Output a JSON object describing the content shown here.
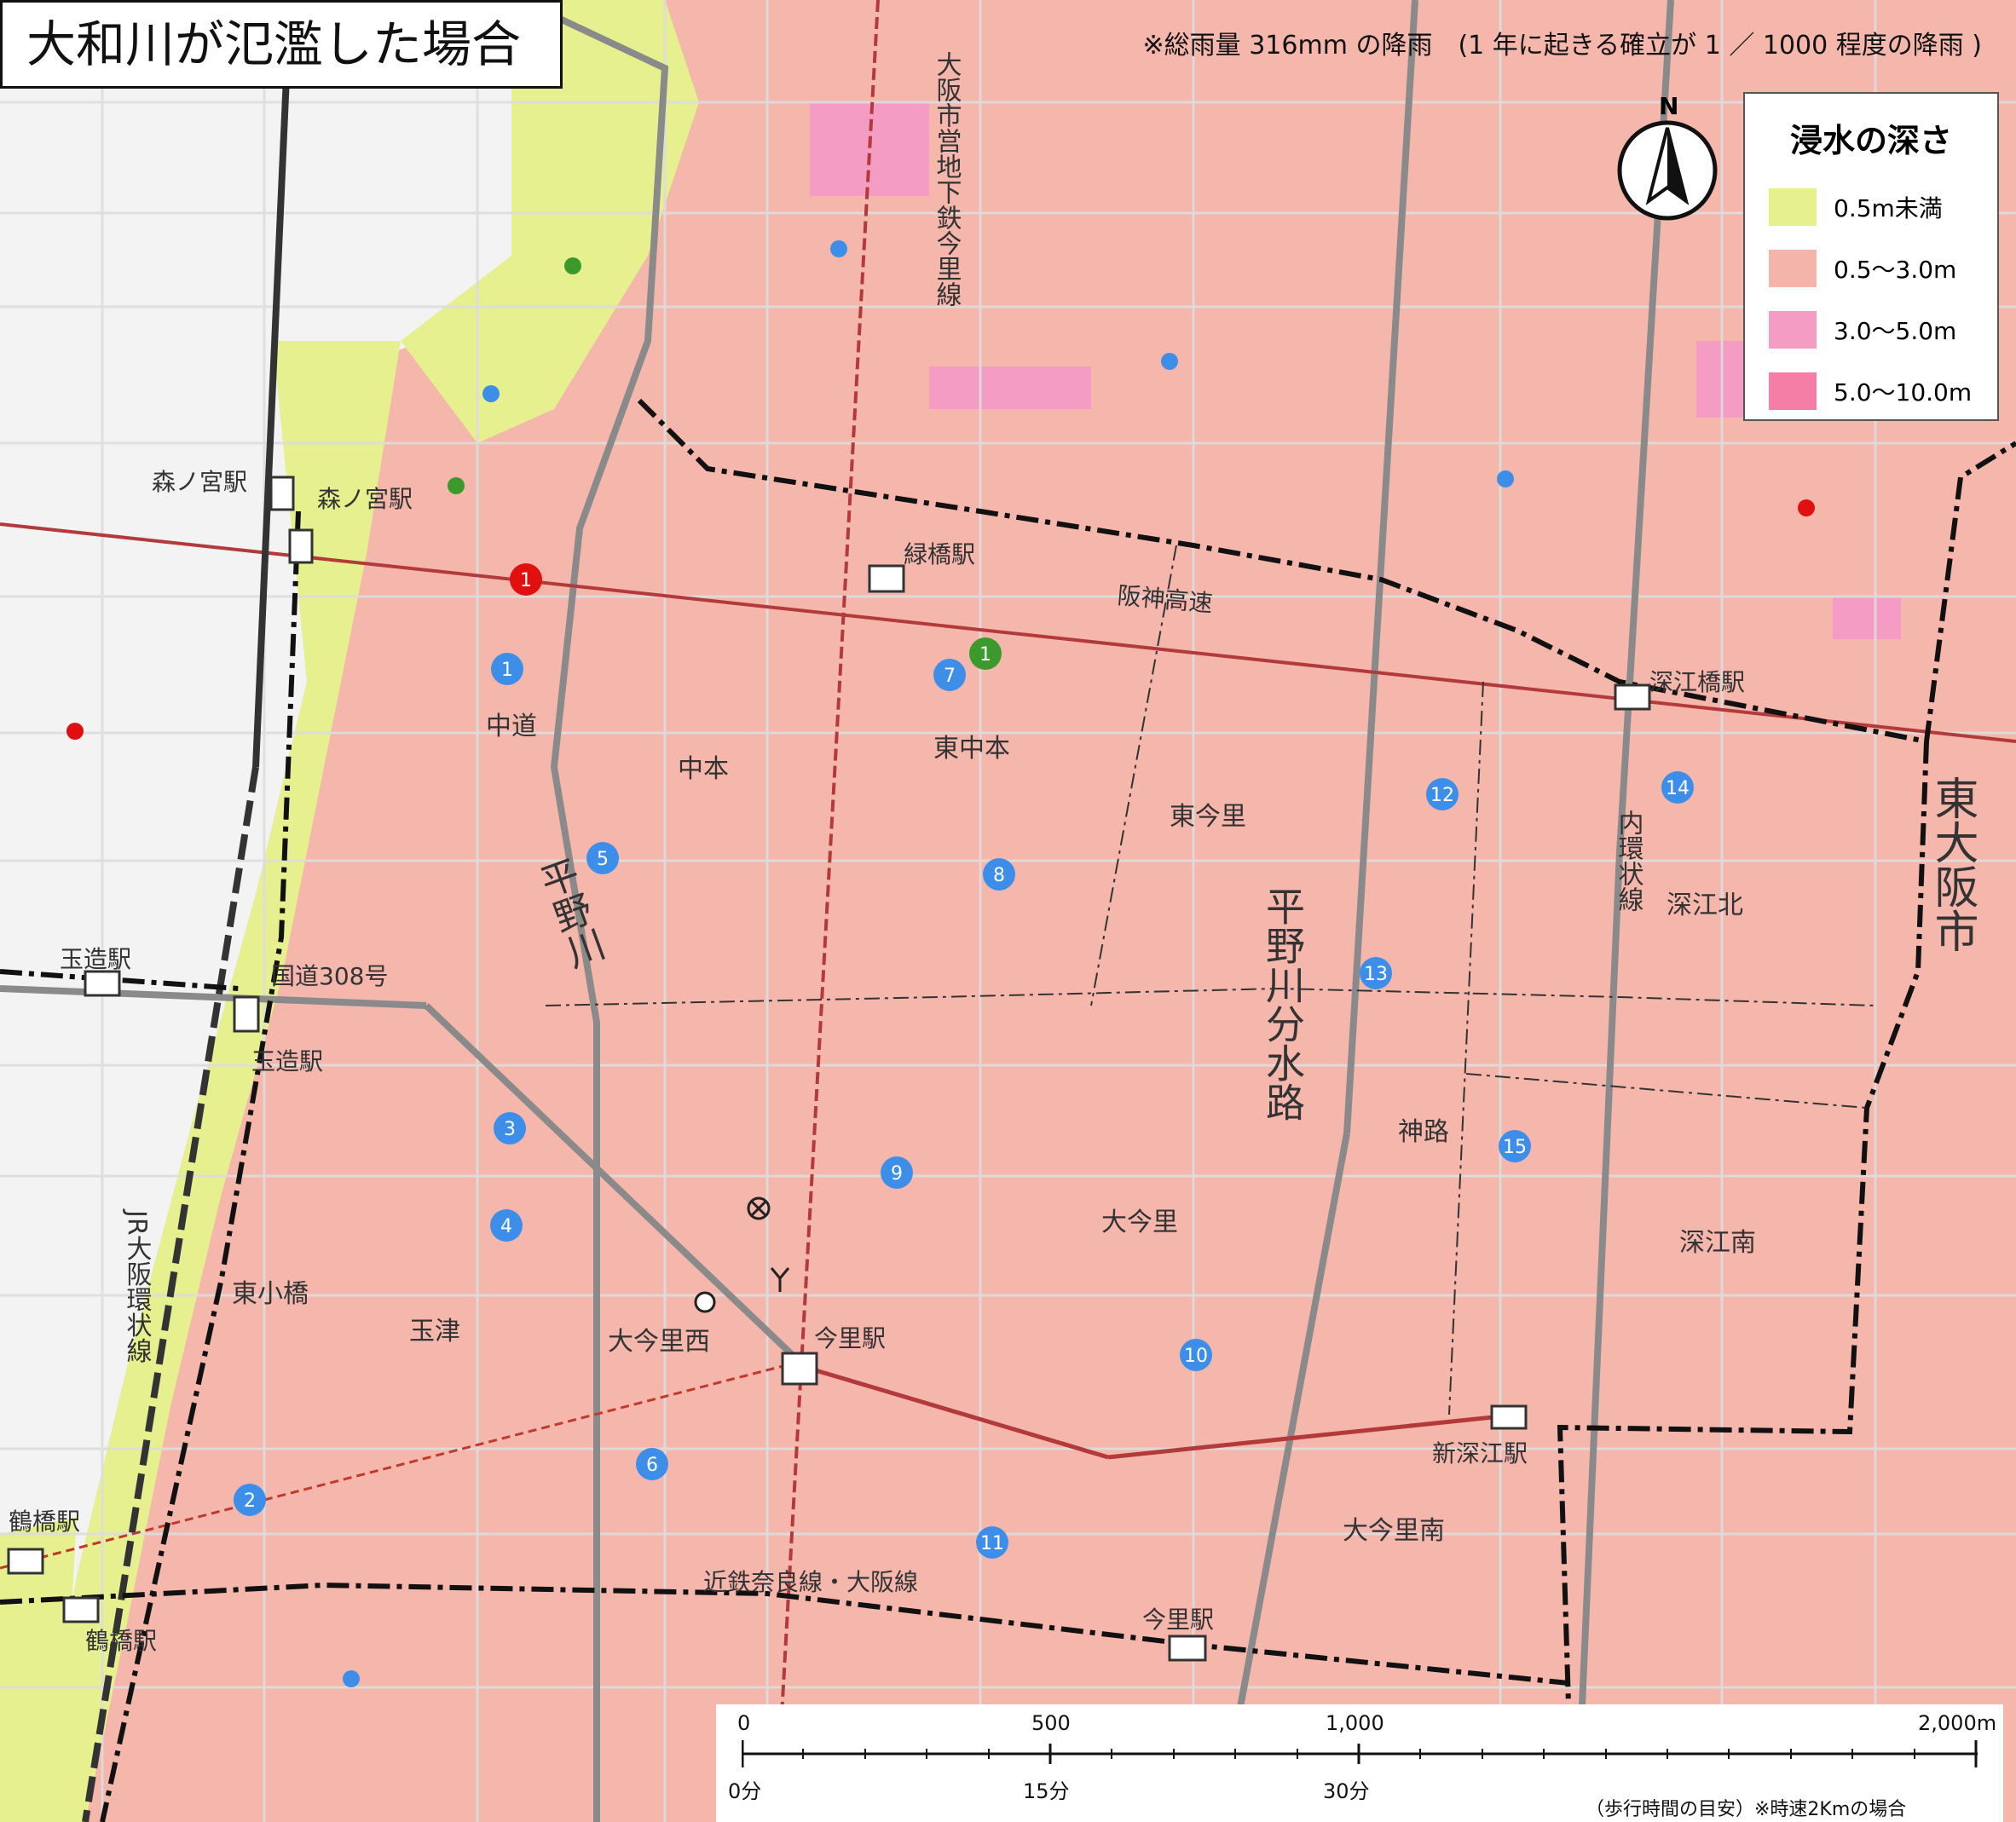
{
  "title": "大和川が氾濫した場合",
  "rainfall_note": "※総雨量 316mm の降雨　(1 年に起きる確立が 1 ／ 1000 程度の降雨 )",
  "compass": {
    "north_label": "N"
  },
  "legend": {
    "title": "浸水の深さ",
    "items": [
      {
        "label": "0.5m未満",
        "color": "#e6f08c"
      },
      {
        "label": "0.5～3.0m",
        "color": "#f5b4aa"
      },
      {
        "label": "3.0～5.0m",
        "color": "#f59cc4"
      },
      {
        "label": "5.0～10.0m",
        "color": "#f47ea6"
      }
    ]
  },
  "map_labels": {
    "stations": [
      "森ノ宮駅",
      "森ノ宮駅",
      "緑橋駅",
      "深江橋駅",
      "玉造駅",
      "玉造駅",
      "今里駅",
      "新深江駅",
      "今里駅",
      "鶴橋駅",
      "鶴橋駅"
    ],
    "districts": [
      "中道",
      "中本",
      "東中本",
      "東今里",
      "深江北",
      "神路",
      "大今里",
      "深江南",
      "東小橋",
      "玉津",
      "大今里西",
      "大今里南"
    ],
    "roads": [
      "阪神高速",
      "国道308号",
      "近鉄奈良線・大阪線"
    ],
    "rail_vertical": "大阪市営地下鉄今里線",
    "rail_jr": "JR大阪環状線",
    "rail_nai": "内環状線",
    "river_main": "平野川",
    "river_div": "平野川分水路",
    "city": "東大阪市"
  },
  "shelters_blue": [
    "1",
    "2",
    "3",
    "4",
    "5",
    "6",
    "7",
    "8",
    "9",
    "10",
    "11",
    "12",
    "13",
    "14",
    "15"
  ],
  "shelters_green": [
    "1"
  ],
  "shelters_red": [
    "1"
  ],
  "scale_bar": {
    "distances": [
      "0",
      "500",
      "1,000",
      "2,000m"
    ],
    "times": [
      "0分",
      "15分",
      "30分"
    ],
    "footnote": "（歩行時間の目安）※時速2Kmの場合"
  }
}
